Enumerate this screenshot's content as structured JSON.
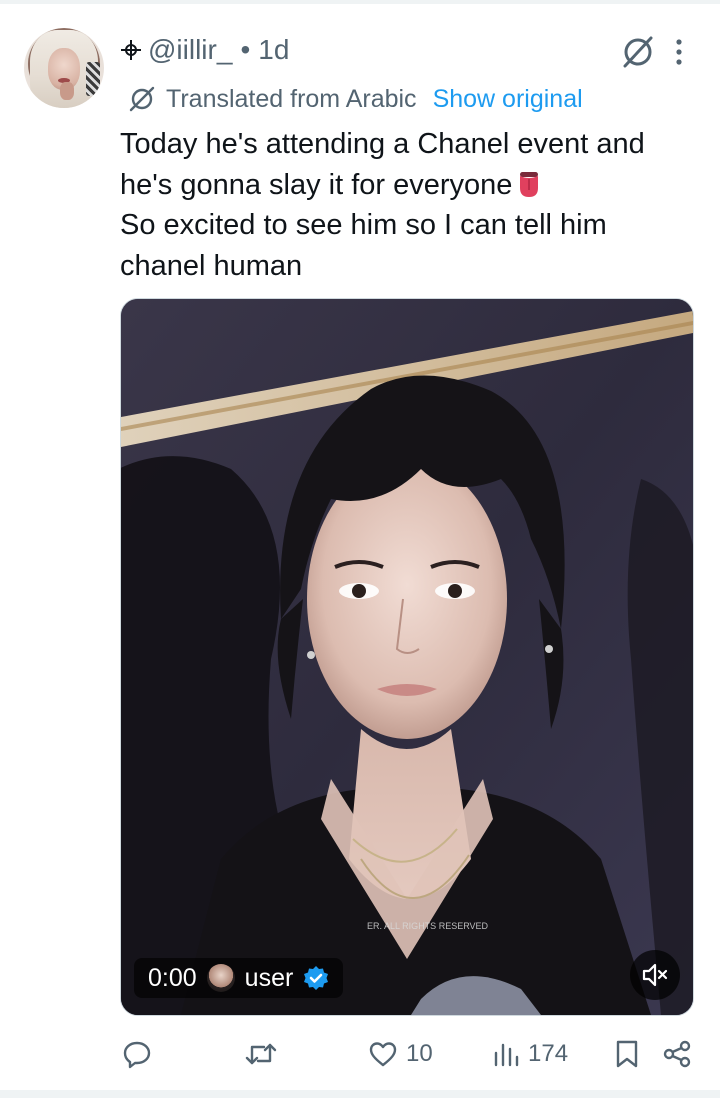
{
  "tweet": {
    "handle": "@iillir_",
    "separator": "•",
    "time": "1d",
    "translation": {
      "label": "Translated from Arabic",
      "show_original": "Show original"
    },
    "text_lines": [
      "Today he's attending a Chanel event and",
      "he's gonna slay it for everyone",
      "So excited to see him so I can tell him",
      "chanel human"
    ],
    "video": {
      "timestamp": "0:00",
      "uploader": "user",
      "watermark": "ER. ALL RIGHTS RESERVED"
    },
    "actions": {
      "reply_count": "",
      "retweet_count": "",
      "like_count": "10",
      "view_count": "174"
    }
  },
  "icons": {
    "header_symbol": "crosshair-icon",
    "grok": "grok-icon",
    "more": "more-vertical-icon",
    "translated": "translate-icon",
    "emoji": "tongue-emoji-icon",
    "verified": "verified-badge-icon",
    "mute": "volume-muted-icon",
    "reply": "reply-icon",
    "retweet": "retweet-icon",
    "like": "heart-icon",
    "views": "views-chart-icon",
    "bookmark": "bookmark-icon",
    "share": "share-icon"
  },
  "colors": {
    "text_primary": "#0f1419",
    "text_secondary": "#536471",
    "link": "#1d9bf0",
    "verified": "#1d9bf0"
  }
}
